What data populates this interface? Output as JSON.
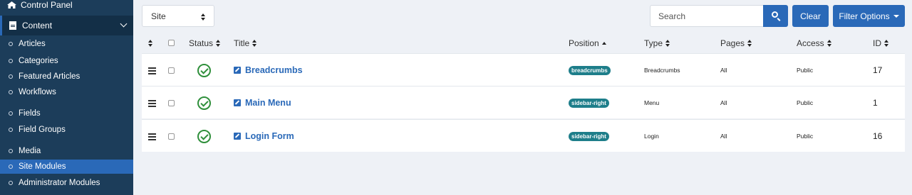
{
  "sidebar": {
    "control_panel": "Control Panel",
    "content": "Content",
    "items": [
      {
        "label": "Articles"
      },
      {
        "label": "Categories"
      },
      {
        "label": "Featured Articles"
      },
      {
        "label": "Workflows"
      },
      {
        "label": "Fields"
      },
      {
        "label": "Field Groups"
      },
      {
        "label": "Media"
      },
      {
        "label": "Site Modules"
      },
      {
        "label": "Administrator Modules"
      }
    ],
    "active": "Site Modules"
  },
  "toolbar": {
    "client_select": "Site",
    "search_placeholder": "Search",
    "clear_label": "Clear",
    "filter_label": "Filter Options"
  },
  "table": {
    "headers": {
      "status": "Status",
      "title": "Title",
      "position": "Position",
      "type": "Type",
      "pages": "Pages",
      "access": "Access",
      "id": "ID"
    },
    "rows": [
      {
        "title": "Breadcrumbs",
        "position": "breadcrumbs",
        "type": "Breadcrumbs",
        "pages": "All",
        "access": "Public",
        "id": "17"
      },
      {
        "title": "Main Menu",
        "position": "sidebar-right",
        "type": "Menu",
        "pages": "All",
        "access": "Public",
        "id": "1"
      },
      {
        "title": "Login Form",
        "position": "sidebar-right",
        "type": "Login",
        "pages": "All",
        "access": "Public",
        "id": "16"
      }
    ]
  },
  "colors": {
    "sidebar_bg": "#1c3d5a",
    "accent": "#2a69b8",
    "published": "#2f8f3b",
    "position_badge": "#1e7e8a"
  }
}
